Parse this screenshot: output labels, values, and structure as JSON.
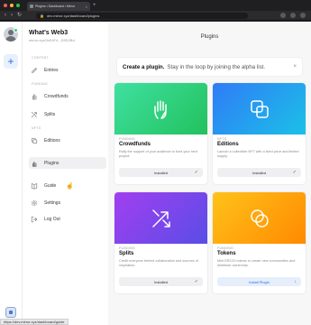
{
  "browser": {
    "dot_colors": [
      "#ff5f57",
      "#febc2e",
      "#28c840"
    ],
    "tab_title": "Plugins • Dashboard • Mirror",
    "tab_close": "×",
    "new_tab": "+",
    "nav": {
      "back": "‹",
      "forward": "›",
      "reload": "↻"
    },
    "address": "dev.mirror.xyz/dashboard/plugins",
    "lock": "🔒"
  },
  "rail": {
    "add_label": "+"
  },
  "sidebar": {
    "publication_name": "What's Web3",
    "publication_address": "mirror.xyz/0xE4F4...D9D2Bd",
    "sections": {
      "content": "CONTENT",
      "funding": "FUNDING",
      "nfts": "NFTS"
    },
    "items": {
      "entries": "Entries",
      "crowdfunds": "Crowdfunds",
      "splits": "Splits",
      "editions": "Editions",
      "plugins": "Plugins",
      "guide": "Guide",
      "settings": "Settings",
      "logout": "Log Out"
    }
  },
  "main": {
    "page_title": "Plugins",
    "banner": {
      "title": "Create a plugin.",
      "text": "Stay in the loop by joining the alpha list.",
      "close": "×"
    },
    "cards": [
      {
        "tag": "FUNDING",
        "name": "Crowdfunds",
        "description": "Rally the support of your audience to fund your next project.",
        "button": "Installed",
        "button_icon": "✓",
        "gradient": [
          "#3fe0a0",
          "#22c15e"
        ]
      },
      {
        "tag": "NFTS",
        "name": "Editions",
        "description": "Launch a collectible NFT with a fixed price and limited supply.",
        "button": "Installed",
        "button_icon": "✓",
        "gradient": [
          "#2f7cf6",
          "#1cc0e8"
        ]
      },
      {
        "tag": "FUNDING",
        "name": "Splits",
        "description": "Credit everyone behind collaboration and sources of inspiration.",
        "button": "Installed",
        "button_icon": "✓",
        "gradient": [
          "#a23ff0",
          "#5a4de6"
        ]
      },
      {
        "tag": "FUNDING",
        "name": "Tokens",
        "description": "Mint ERC20 tokens to create new communities and distribute ownership.",
        "button": "Install Plugin",
        "button_icon": "↓",
        "gradient": [
          "#ffc21a",
          "#ff8a00"
        ]
      }
    ]
  },
  "statusbar": {
    "url": "https://dev.mirror.xyz/dashboard/guide"
  }
}
